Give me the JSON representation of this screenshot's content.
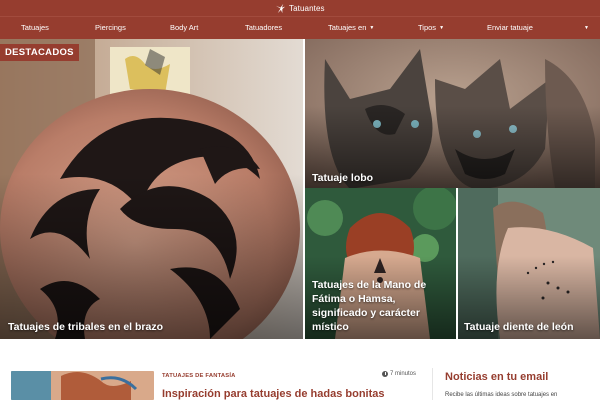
{
  "site": {
    "name": "Tatuantes"
  },
  "nav": {
    "items": [
      {
        "label": "Tatuajes",
        "dropdown": false
      },
      {
        "label": "Piercings",
        "dropdown": false
      },
      {
        "label": "Body Art",
        "dropdown": false
      },
      {
        "label": "Tatuadores",
        "dropdown": false
      },
      {
        "label": "Tatuajes en",
        "dropdown": true
      },
      {
        "label": "Tipos",
        "dropdown": true
      },
      {
        "label": "Enviar tatuaje",
        "dropdown": false
      }
    ],
    "more_caret": "▼"
  },
  "featured": {
    "badge": "DESTACADOS",
    "tiles": [
      {
        "title": "Tatuajes de tribales en el brazo"
      },
      {
        "title": "Tatuaje lobo"
      },
      {
        "title": "Tatuajes de la Mano de Fátima o Hamsa, significado y carácter místico"
      },
      {
        "title": "Tatuaje diente de león"
      }
    ]
  },
  "article": {
    "category": "TATUAJES DE FANTASÍA",
    "read_time": "7 minutos",
    "title": "Inspiración para tatuajes de hadas bonitas"
  },
  "sidebar": {
    "title": "Noticias en tu email",
    "text": "Recibe las últimas ideas sobre tatuajes en"
  },
  "colors": {
    "brand": "#963d2f",
    "white": "#ffffff"
  }
}
